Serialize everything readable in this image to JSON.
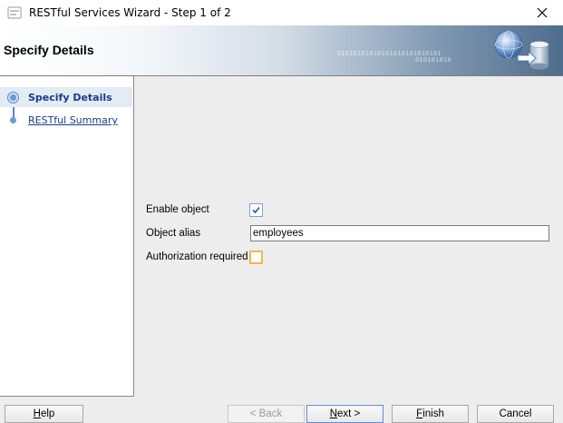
{
  "window": {
    "title": "RESTful Services Wizard - Step 1 of 2",
    "close_icon": "close-icon"
  },
  "banner": {
    "title": "Specify Details",
    "binary_text_1": "01010101010101010101010101",
    "binary_text_2": "010101010"
  },
  "nav": {
    "items": [
      {
        "label": "Specify Details",
        "active": true
      },
      {
        "label": "RESTful Summary",
        "active": false
      }
    ]
  },
  "form": {
    "enable_object_label": "Enable object",
    "enable_object_checked": true,
    "object_alias_label": "Object alias",
    "object_alias_value": "employees",
    "authorization_label": "Authorization required",
    "authorization_checked": false
  },
  "buttons": {
    "help": "Help",
    "back": "< Back",
    "next": "Next >",
    "finish": "Finish",
    "cancel": "Cancel"
  },
  "colors": {
    "nav_link": "#1a3c8c",
    "nav_active_bg": "#e3ebf5",
    "checkbox_focus": "#f0b850",
    "checkbox_check": "#2b5aa3"
  }
}
